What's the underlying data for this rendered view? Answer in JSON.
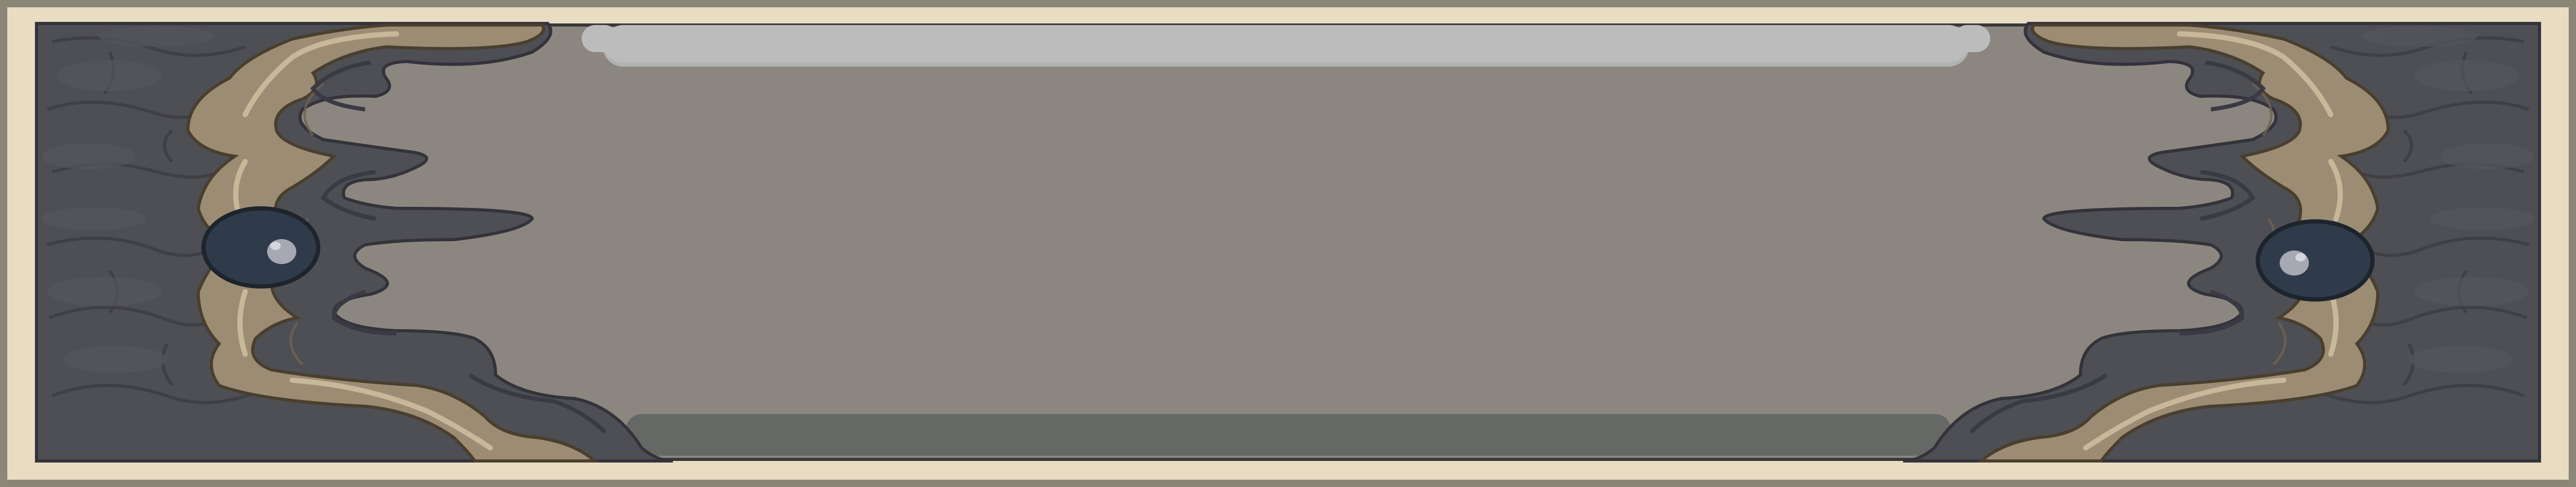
{
  "screen": {
    "type": "game-ui-frame-banner",
    "colors": {
      "outer_border": "#8b8677",
      "background": "#e8dcc2",
      "panel": "#8b8780",
      "top_bar": "#bcbcbc",
      "bottom_bar": "#666866",
      "stone": "#4e4f54",
      "stone_dark": "#3f3f46",
      "wood": "#9c8c74",
      "wood_highlight": "#c8b89a",
      "gem": "#2f3a4a",
      "gem_highlight": "#a8a8b4"
    }
  },
  "decorations": {
    "left": {
      "icon": "stone-flame-ornament-icon",
      "gem_icon": "dark-gem-icon"
    },
    "right": {
      "icon": "stone-flame-ornament-icon",
      "gem_icon": "dark-gem-icon"
    }
  }
}
